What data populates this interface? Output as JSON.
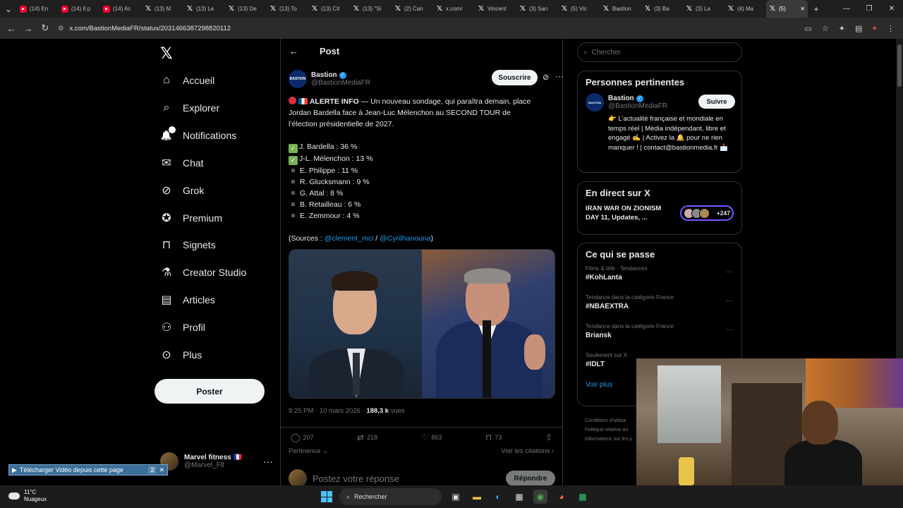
{
  "browser": {
    "tabs": [
      {
        "icon": "youtube",
        "label": "(14) En"
      },
      {
        "icon": "youtube",
        "label": "(14) Il p"
      },
      {
        "icon": "youtube",
        "label": "(14) Ac"
      },
      {
        "icon": "x",
        "label": "(13) M"
      },
      {
        "icon": "x",
        "label": "(13) Le"
      },
      {
        "icon": "x",
        "label": "(13) De"
      },
      {
        "icon": "x",
        "label": "(13) To"
      },
      {
        "icon": "x",
        "label": "(13) Cit"
      },
      {
        "icon": "x",
        "label": "(13) \"Si"
      },
      {
        "icon": "x",
        "label": "(2) Can"
      },
      {
        "icon": "x",
        "label": "x.com/"
      },
      {
        "icon": "x",
        "label": "Vincent"
      },
      {
        "icon": "x",
        "label": "(3) San"
      },
      {
        "icon": "x",
        "label": "(5) Vic"
      },
      {
        "icon": "x",
        "label": "Bastion"
      },
      {
        "icon": "x",
        "label": "(3) Ba"
      },
      {
        "icon": "x",
        "label": "(3) La"
      },
      {
        "icon": "x",
        "label": "(4) Ma"
      },
      {
        "icon": "x",
        "label": "(5)"
      }
    ],
    "url": "x.com/BastionMediaFR/status/2031466387298820112"
  },
  "nav": {
    "items": [
      {
        "label": "Accueil",
        "icon": "home-icon"
      },
      {
        "label": "Explorer",
        "icon": "search-icon"
      },
      {
        "label": "Notifications",
        "icon": "bell-icon",
        "badge": "5"
      },
      {
        "label": "Chat",
        "icon": "mail-icon"
      },
      {
        "label": "Grok",
        "icon": "grok-icon"
      },
      {
        "label": "Premium",
        "icon": "premium-icon"
      },
      {
        "label": "Signets",
        "icon": "bookmark-icon"
      },
      {
        "label": "Creator Studio",
        "icon": "flask-icon"
      },
      {
        "label": "Articles",
        "icon": "article-icon"
      },
      {
        "label": "Profil",
        "icon": "person-icon"
      },
      {
        "label": "Plus",
        "icon": "more-circle-icon"
      }
    ],
    "post_button": "Poster",
    "account": {
      "name": "Marvel fitness 🇫🇷",
      "handle": "@Marvel_Flt"
    }
  },
  "post": {
    "header_title": "Post",
    "author": {
      "name": "Bastion",
      "handle": "@BastionMediaFR",
      "avatar_text": "BASTION"
    },
    "subscribe_label": "Souscrire",
    "intro_bold": "ALERTE INFO",
    "intro_text": " — Un nouveau sondage, qui paraîtra demain, place",
    "line2": "Jordan Bardella face à Jean-Luc Mélenchon au SECOND TOUR de",
    "line3": "l’élection présidentielle de 2027.",
    "results_checked": [
      "J. Bardella : 36 %",
      "J-L. Mélenchon : 13 %"
    ],
    "results_other": [
      "E. Philippe : 11 %",
      "R. Glucksmann : 9 %",
      "G. Attal : 8 %",
      "B. Retailleau : 6 %",
      "E. Zemmour : 4 %"
    ],
    "sources_prefix": "(Sources : ",
    "source1": "@clement_mci",
    "sources_sep": " / ",
    "source2": "@Cyrilhanouna",
    "sources_suffix": ")",
    "time": "9:25 PM · 10 mars 2026 · ",
    "views_count": "188,3 k",
    "views_label": " vues",
    "stats": {
      "replies": "207",
      "reposts": "218",
      "likes": "863",
      "bookmarks": "73"
    },
    "sort_label": "Pertinence",
    "citations_label": "Voir les citations",
    "reply_placeholder": "Postez votre réponse",
    "reply_button": "Répondre"
  },
  "right": {
    "search_placeholder": "Chercher",
    "relevant_title": "Personnes pertinentes",
    "relevant": {
      "name": "Bastion",
      "handle": "@BastionMediaFR",
      "follow": "Suivre",
      "bio": "👉 L’actualité française et mondiale en temps réel | Média indépendant, libre et engagé ✍️ | Activez la 🔔 pour ne rien manquer ! | contact@bastionmedia.fr 📩"
    },
    "live_title": "En direct sur X",
    "live_item": "IRAN WAR ON ZIONISM DAY 11, Updates, ...",
    "live_count": "+247",
    "happening_title": "Ce qui se passe",
    "trends": [
      {
        "context": "Films & télé · Tendances",
        "name": "#KohLanta"
      },
      {
        "context": "Tendance dans la catégorie France",
        "name": "#NBAEXTRA"
      },
      {
        "context": "Tendance dans la catégorie France",
        "name": "Briansk"
      },
      {
        "context": "Seulement sur X ·",
        "name": "#IDLT"
      }
    ],
    "show_more": "Voir plus",
    "footer": [
      "Conditions d'utilisa",
      "Politique relative au",
      "Informations sur les p"
    ]
  },
  "download_bar": {
    "label": "Télécharger Vidéo depuis cette page",
    "count": "2"
  },
  "taskbar": {
    "temp": "11°C",
    "weather": "Nuageux",
    "search": "Rechercher"
  },
  "colors": {
    "accent": "#1d9bf0",
    "bg": "#000000",
    "border": "#2f3336",
    "muted": "#71767b"
  }
}
